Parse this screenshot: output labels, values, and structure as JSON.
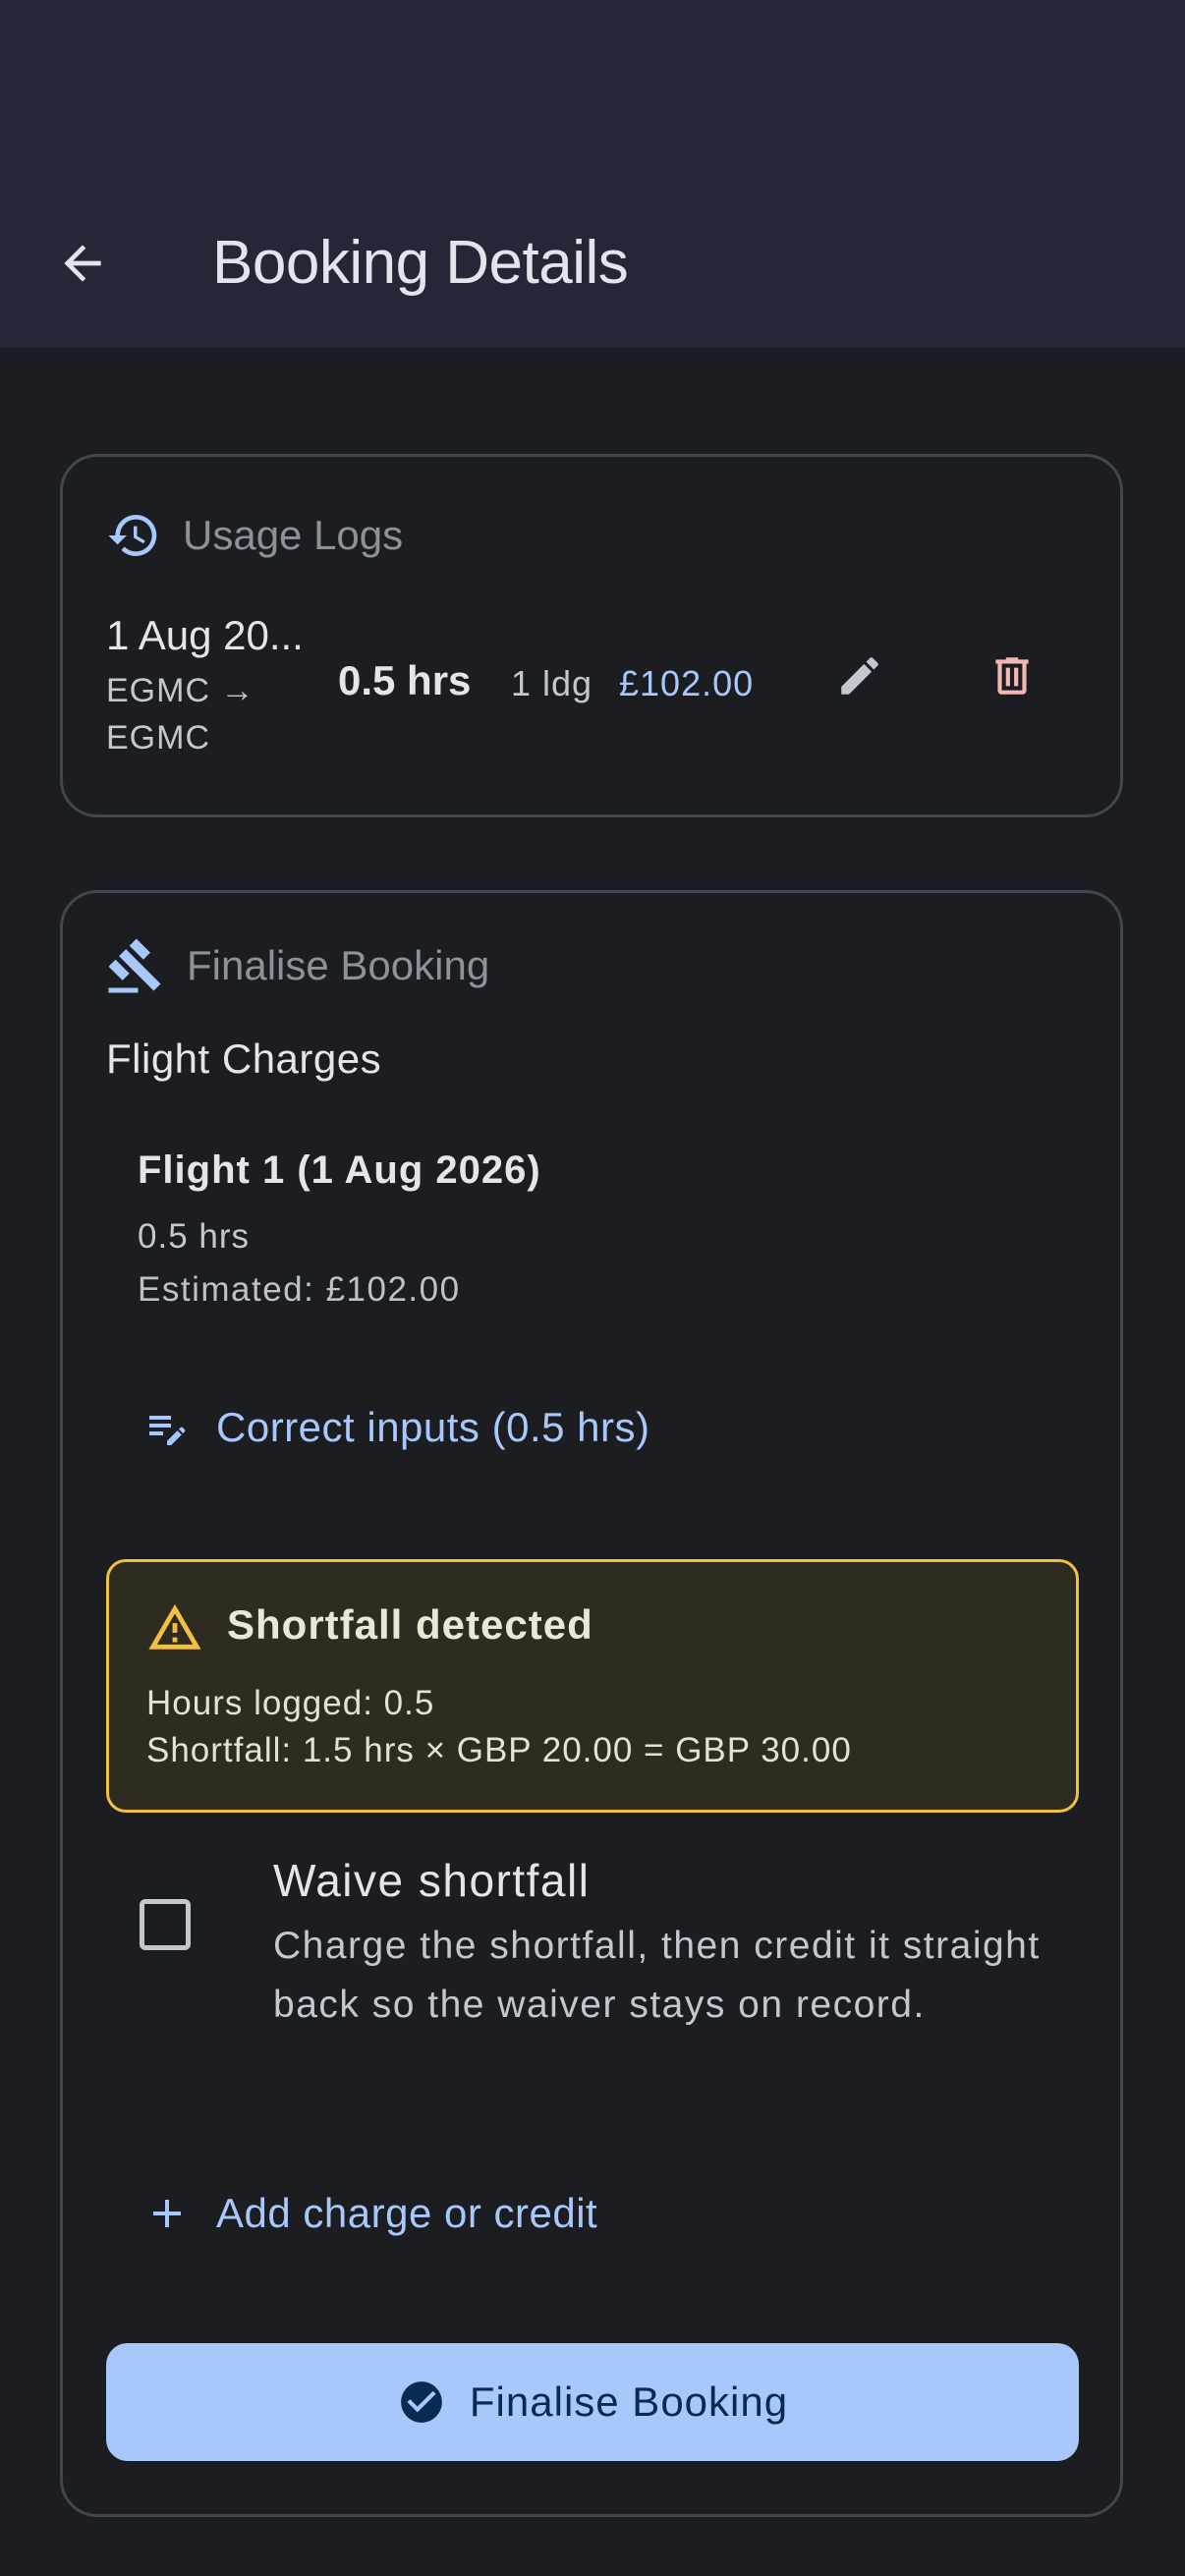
{
  "header": {
    "title": "Booking Details"
  },
  "usage_logs": {
    "title": "Usage Logs",
    "entry": {
      "date": "1 Aug 20...",
      "route": "EGMC → EGMC",
      "hours": "0.5 hrs",
      "landings": "1 ldg",
      "amount": "£102.00"
    }
  },
  "finalise": {
    "title": "Finalise Booking",
    "section_title": "Flight Charges",
    "flight": {
      "title": "Flight 1 (1 Aug 2026)",
      "hours": "0.5 hrs",
      "estimated": "Estimated: £102.00"
    },
    "correct_inputs_label": "Correct inputs (0.5 hrs)",
    "shortfall": {
      "title": "Shortfall detected",
      "hours_logged": "Hours logged: 0.5",
      "detail": "Shortfall: 1.5 hrs × GBP 20.00 = GBP 30.00"
    },
    "waive": {
      "title": "Waive shortfall",
      "description": "Charge the shortfall, then credit it straight back so the waiver stays on record.",
      "checked": false
    },
    "add_charge_label": "Add charge or credit",
    "finalise_button_label": "Finalise Booking"
  },
  "colors": {
    "accent": "#a8c7fa",
    "warning": "#f0c043",
    "danger": "#f2b8b5"
  }
}
